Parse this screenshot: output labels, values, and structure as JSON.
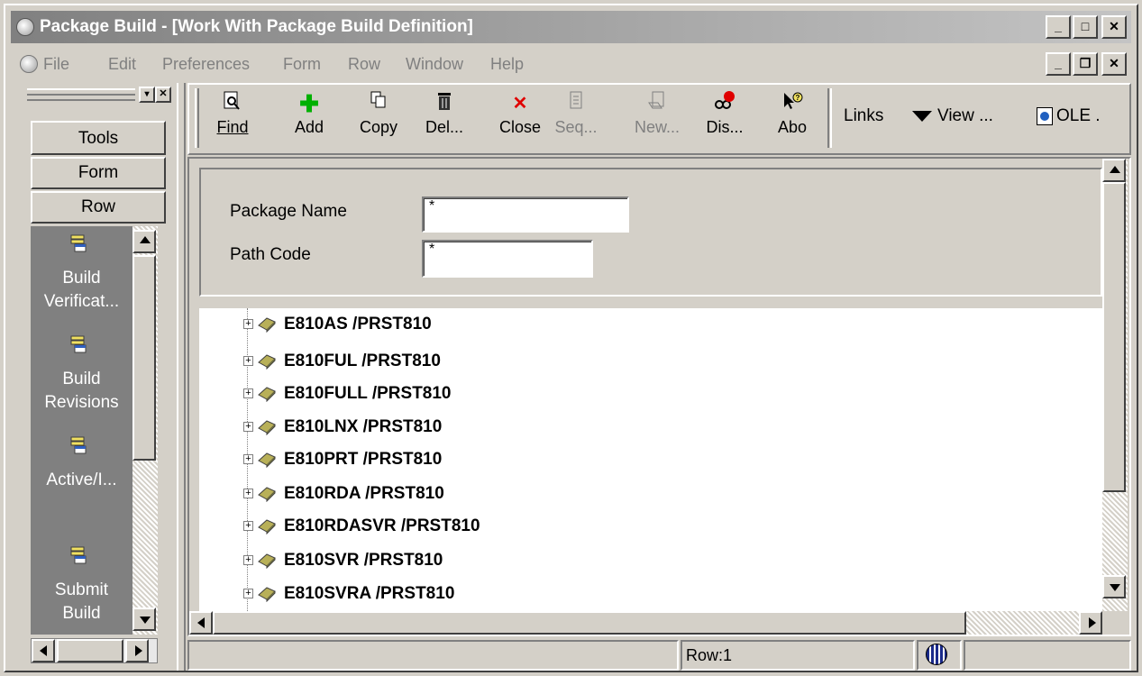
{
  "window": {
    "title": "Package Build - [Work With Package Build Definition]",
    "controls": [
      "_",
      "□",
      "✕"
    ]
  },
  "menubar": {
    "items": [
      "File",
      "Edit",
      "Preferences",
      "Form",
      "Row",
      "Window",
      "Help"
    ]
  },
  "leftpanel": {
    "tools_label": "Tools",
    "form_label": "Form",
    "row_label": "Row",
    "exits": [
      {
        "label1": "Build",
        "label2": "Verificat..."
      },
      {
        "label1": "Build",
        "label2": "Revisions"
      },
      {
        "label1": "Active/I...",
        "label2": ""
      },
      {
        "label1": "Submit",
        "label2": "Build"
      }
    ]
  },
  "toolbar": {
    "buttons": [
      {
        "label": "Find",
        "icon": "find-icon"
      },
      {
        "label": "Add",
        "icon": "add-icon"
      },
      {
        "label": "Copy",
        "icon": "copy-icon"
      },
      {
        "label": "Del...",
        "icon": "delete-icon"
      },
      {
        "label": "Close",
        "icon": "close-icon"
      },
      {
        "label": "Seq...",
        "icon": "sequence-icon"
      },
      {
        "label": "New...",
        "icon": "new-icon"
      },
      {
        "label": "Dis...",
        "icon": "display-icon"
      },
      {
        "label": "Abo",
        "icon": "about-icon"
      }
    ],
    "links_label": "Links",
    "view_label": "View ...",
    "ole_label": "OLE ."
  },
  "form": {
    "package_name_label": "Package Name",
    "package_name_value": "*",
    "path_code_label": "Path Code",
    "path_code_value": "*"
  },
  "tree": {
    "items": [
      "E810AS /PRST810",
      "E810FUL /PRST810",
      "E810FULL /PRST810",
      "E810LNX /PRST810",
      "E810PRT /PRST810",
      "E810RDA /PRST810",
      "E810RDASVR /PRST810",
      "E810SVR /PRST810",
      "E810SVRA /PRST810"
    ]
  },
  "statusbar": {
    "row_text": "Row:1"
  },
  "colors": {
    "face": "#d4d0c8",
    "titlebar": "#808080",
    "exitpane": "#808080",
    "book": "#b8b058"
  }
}
